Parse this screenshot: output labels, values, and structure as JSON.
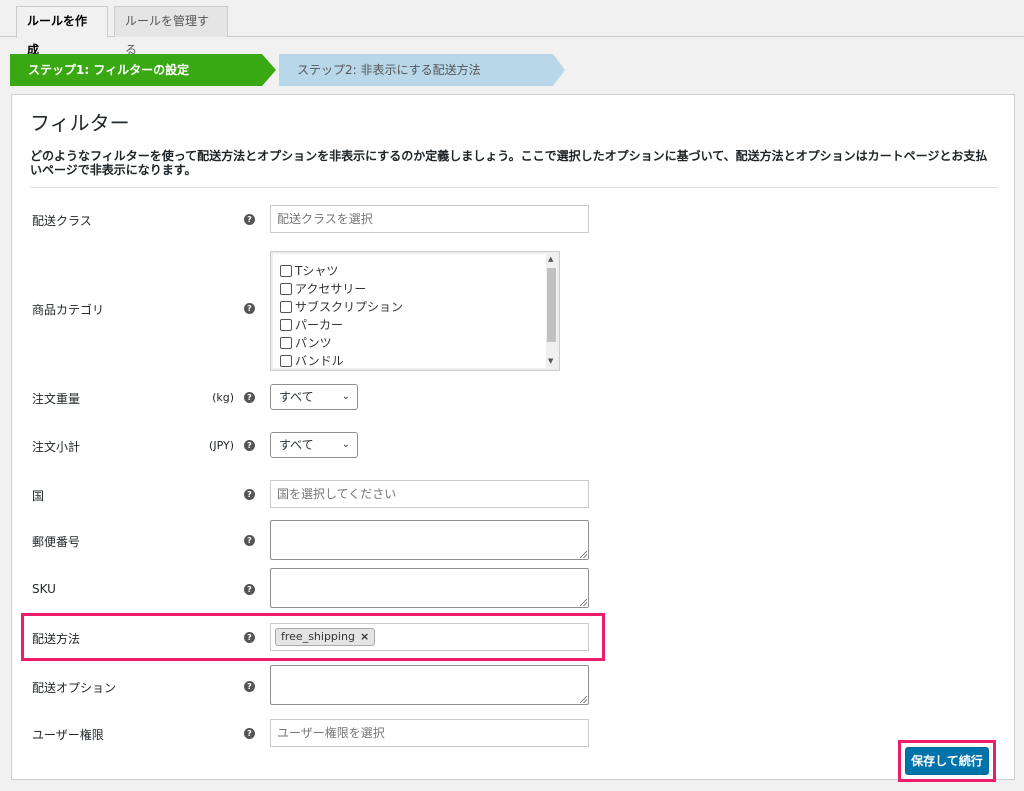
{
  "tabs": [
    {
      "label": "ルールを作成",
      "active": true
    },
    {
      "label": "ルールを管理する",
      "active": false
    }
  ],
  "steps": [
    {
      "label": "ステップ1: フィルターの設定",
      "active": true,
      "color": "#3aa813"
    },
    {
      "label": "ステップ2: 非表示にする配送方法",
      "active": false,
      "color": "#b8d8ea"
    }
  ],
  "panel": {
    "title": "フィルター",
    "description": "どのようなフィルターを使って配送方法とオプションを非表示にするのか定義しましょう。ここで選択したオプションに基づいて、配送方法とオプションはカートページとお支払いページで非表示になります。"
  },
  "fields": {
    "shipping_class": {
      "label": "配送クラス",
      "placeholder": "配送クラスを選択"
    },
    "product_category": {
      "label": "商品カテゴリ",
      "options": [
        "Tシャツ",
        "アクセサリー",
        "サブスクリプション",
        "パーカー",
        "パンツ",
        "バンドル"
      ]
    },
    "order_weight": {
      "label": "注文重量",
      "unit": "(kg)",
      "value": "すべて"
    },
    "order_subtotal": {
      "label": "注文小計",
      "unit": "(JPY)",
      "value": "すべて"
    },
    "country": {
      "label": "国",
      "placeholder": "国を選択してください"
    },
    "postcode": {
      "label": "郵便番号"
    },
    "sku": {
      "label": "SKU"
    },
    "shipping_method": {
      "label": "配送方法",
      "tokens": [
        "free_shipping"
      ]
    },
    "shipping_option": {
      "label": "配送オプション"
    },
    "user_role": {
      "label": "ユーザー権限",
      "placeholder": "ユーザー権限を選択"
    }
  },
  "buttons": {
    "save_continue": "保存して続行"
  },
  "icons": {
    "help": "?",
    "remove": "×",
    "chevron": "⌄",
    "scroll_up": "▲",
    "scroll_down": "▼"
  },
  "colors": {
    "highlight": "#ec1d6a",
    "primary_button": "#0073aa"
  }
}
